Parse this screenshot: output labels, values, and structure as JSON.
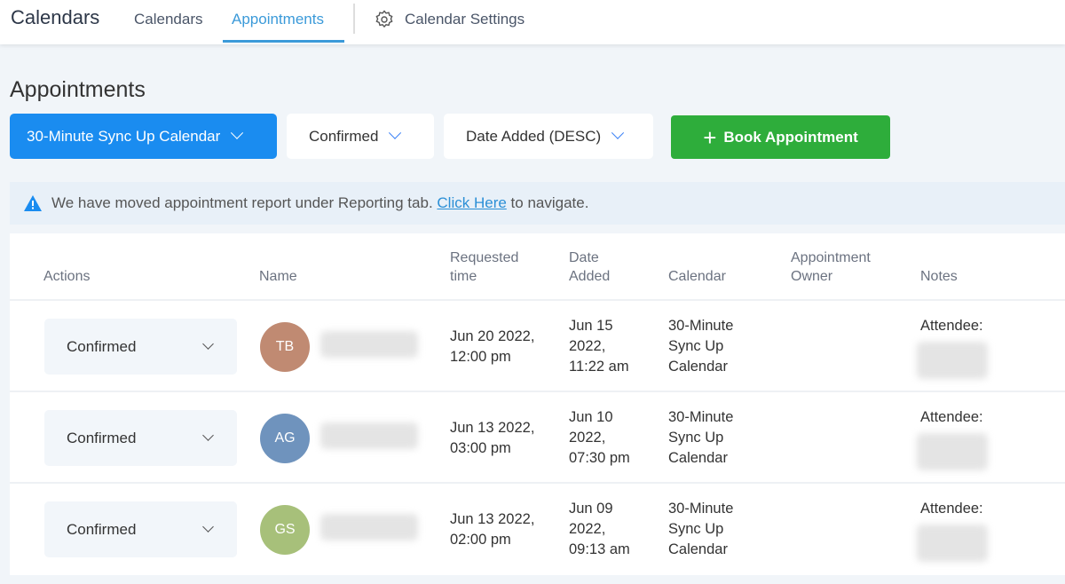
{
  "header": {
    "brand": "Calendars",
    "tabs": [
      {
        "label": "Calendars"
      },
      {
        "label": "Appointments"
      },
      {
        "label": "Calendar Settings"
      }
    ]
  },
  "page_title": "Appointments",
  "filters": {
    "calendar": "30-Minute Sync Up Calendar",
    "status": "Confirmed",
    "sort": "Date Added (DESC)",
    "book_button": "Book Appointment"
  },
  "banner": {
    "text": "We have moved appointment report under Reporting tab.",
    "link": "Click Here",
    "suffix": "to navigate."
  },
  "table": {
    "headers": {
      "actions": "Actions",
      "name": "Name",
      "requested_1": "Requested",
      "requested_2": "time",
      "added_1": "Date",
      "added_2": "Added",
      "calendar": "Calendar",
      "owner_1": "Appointment",
      "owner_2": "Owner",
      "notes": "Notes"
    },
    "rows": [
      {
        "status": "Confirmed",
        "initials": "TB",
        "avatar_color": "#c08a72",
        "req1": "Jun 20 2022,",
        "req2": "12:00 pm",
        "add1": "Jun 15",
        "add2": "2022,",
        "add3": "11:22 am",
        "cal1": "30-Minute",
        "cal2": "Sync Up",
        "cal3": "Calendar",
        "notes": "Attendee:"
      },
      {
        "status": "Confirmed",
        "initials": "AG",
        "avatar_color": "#6f93bd",
        "req1": "Jun 13 2022,",
        "req2": "03:00 pm",
        "add1": "Jun 10",
        "add2": "2022,",
        "add3": "07:30 pm",
        "cal1": "30-Minute",
        "cal2": "Sync Up",
        "cal3": "Calendar",
        "notes": "Attendee:"
      },
      {
        "status": "Confirmed",
        "initials": "GS",
        "avatar_color": "#a7c07a",
        "req1": "Jun 13 2022,",
        "req2": "02:00 pm",
        "add1": "Jun 09",
        "add2": "2022,",
        "add3": "09:13 am",
        "cal1": "30-Minute",
        "cal2": "Sync Up",
        "cal3": "Calendar",
        "notes": "Attendee:"
      }
    ]
  }
}
